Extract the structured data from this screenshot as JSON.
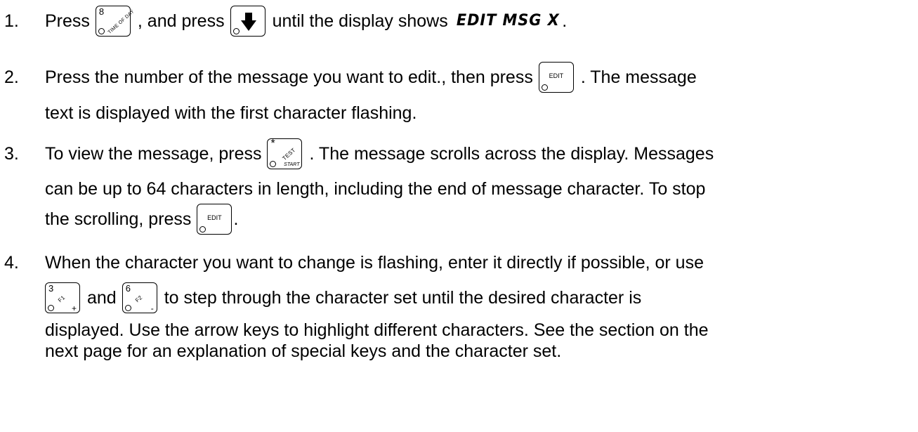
{
  "steps": [
    {
      "number": "1.",
      "press_1": "Press",
      "mid_text": ", and press",
      "until_text": "until the display shows",
      "display_text": "EDIT MSG X",
      "period": "."
    },
    {
      "number": "2.",
      "text_before": "Press the number of the message you want to edit., then press",
      "text_after": ".  The message",
      "cont": "text is displayed with the first character flashing."
    },
    {
      "number": "3.",
      "text_before": "To view the message, press",
      "text_after": ".  The message scrolls across the display.  Messages",
      "cont_1": "can be up to 64 characters in length, including the end of message character. To stop",
      "cont_2_before": "the scrolling, press",
      "cont_2_after": "."
    },
    {
      "number": "4.",
      "text": "When the character you want to change is flashing, enter it directly if possible, or use",
      "and_text": "and",
      "step_text": "to step through the character set until the desired character is",
      "cont_1": "displayed.  Use the arrow keys to highlight different characters.  See the section on the",
      "cont_2": "next page for an explanation of special keys and the character set."
    }
  ],
  "keys": {
    "time_of_day": {
      "number": "8",
      "label": "TIME OF DAY"
    },
    "down_arrow": {
      "icon": "down-arrow-icon"
    },
    "edit": {
      "label": "EDIT"
    },
    "test_start": {
      "symbol": "*",
      "label": "TEST",
      "sub_label": "START"
    },
    "f1_plus": {
      "number": "3",
      "label": "F1",
      "sign": "+"
    },
    "f2_minus": {
      "number": "6",
      "label": "F2",
      "sign": "-"
    }
  }
}
